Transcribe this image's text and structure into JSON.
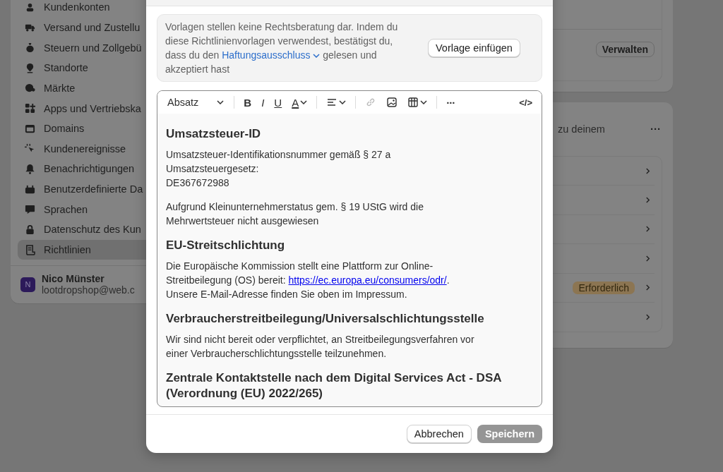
{
  "sidebar": {
    "items": [
      {
        "label": "Kundenkonten",
        "selected": false
      },
      {
        "label": "Versand und Zustellu",
        "selected": false
      },
      {
        "label": "Steuern und Zollgebü",
        "selected": false
      },
      {
        "label": "Standorte",
        "selected": false
      },
      {
        "label": "Märkte",
        "selected": false
      },
      {
        "label": "Apps und Vertriebska",
        "selected": false
      },
      {
        "label": "Domains",
        "selected": false
      },
      {
        "label": "Kundenereignisse",
        "selected": false
      },
      {
        "label": "Benachrichtigungen",
        "selected": false
      },
      {
        "label": "Benutzerdefinierte Da",
        "selected": false
      },
      {
        "label": "Sprachen",
        "selected": false
      },
      {
        "label": "Datenschutz des Kun",
        "selected": false
      },
      {
        "label": "Richtlinien",
        "selected": true
      }
    ],
    "user": {
      "initial": "N",
      "name": "Nico Münster",
      "email": "lootdropshop@web.c"
    }
  },
  "right": {
    "card_1": {
      "button": "Verwalten"
    },
    "card_2": {
      "text": "zu deinem",
      "more": "···",
      "rows": [
        {},
        {},
        {},
        {},
        {
          "badge": "Erforderlich"
        },
        {}
      ]
    }
  },
  "modal": {
    "notice": {
      "before": "Vorlagen stellen keine Rechtsberatung dar. Indem du diese Richtlinienvorlagen verwendest, bestätigst du, dass du den ",
      "link": "Haftungsausschluss",
      "after": " gelesen und akzeptiert hast",
      "button": "Vorlage einfügen"
    },
    "toolbar": {
      "format": "Absatz",
      "tools": [
        {
          "kind": "bold",
          "label": "B",
          "caret": false
        },
        {
          "kind": "italic",
          "label": "I",
          "caret": false
        },
        {
          "kind": "underline",
          "label": "U",
          "caret": false
        },
        {
          "kind": "color",
          "label": "A",
          "caret": true
        },
        {
          "kind": "sep"
        },
        {
          "kind": "align",
          "caret": true
        },
        {
          "kind": "sep"
        },
        {
          "kind": "link",
          "disabled": true,
          "caret": false
        },
        {
          "kind": "image",
          "caret": false
        },
        {
          "kind": "table",
          "caret": true
        },
        {
          "kind": "sep"
        },
        {
          "kind": "more",
          "label": "···",
          "caret": false
        }
      ],
      "code": "</>"
    },
    "content": [
      {
        "kind": "heading",
        "lines": [
          [
            {
              "text": "Umsatzsteuer-ID"
            }
          ]
        ]
      },
      {
        "kind": "paragraph",
        "lines": [
          [
            {
              "text": "Umsatzsteuer-Identifikationsnummer gemäß § 27 a"
            }
          ],
          [
            {
              "text": "Umsatzsteuergesetz:"
            }
          ],
          [
            {
              "text": "DE367672988"
            }
          ]
        ]
      },
      {
        "kind": "paragraph",
        "lines": [
          [
            {
              "text": "Aufgrund Kleinunternehmerstatus gem. § 19 UStG wird die"
            }
          ],
          [
            {
              "text": "Mehrwertsteuer nicht ausgewiesen"
            }
          ]
        ]
      },
      {
        "kind": "heading",
        "lines": [
          [
            {
              "text": "EU-Streitschlichtung"
            }
          ]
        ]
      },
      {
        "kind": "paragraph",
        "lines": [
          [
            {
              "text": "Die Europäische Kommission stellt eine Plattform zur Online-"
            }
          ],
          [
            {
              "text": "Streitbeilegung (OS) bereit: "
            },
            {
              "text": "https://ec.europa.eu/consumers/odr/",
              "link": true
            },
            {
              "text": "."
            }
          ],
          [
            {
              "text": "Unsere E-Mail-Adresse finden Sie oben im Impressum."
            }
          ]
        ]
      },
      {
        "kind": "heading",
        "lines": [
          [
            {
              "text": "Verbraucherstreitbeilegung/Universalschlichtungsstelle"
            }
          ]
        ]
      },
      {
        "kind": "paragraph",
        "lines": [
          [
            {
              "text": "Wir sind nicht bereit oder verpflichtet, an Streitbeilegungsverfahren vor"
            }
          ],
          [
            {
              "text": "einer Verbraucherschlichtungsstelle teilzunehmen."
            }
          ]
        ]
      },
      {
        "kind": "heading",
        "lines": [
          [
            {
              "text": "Zentrale Kontaktstelle nach dem Digital Services Act - DSA"
            }
          ],
          [
            {
              "text": "(Verordnung (EU) 2022/265)"
            }
          ]
        ]
      }
    ],
    "footer": {
      "cancel": "Abbrechen",
      "save": "Speichern",
      "save_disabled": true
    }
  }
}
